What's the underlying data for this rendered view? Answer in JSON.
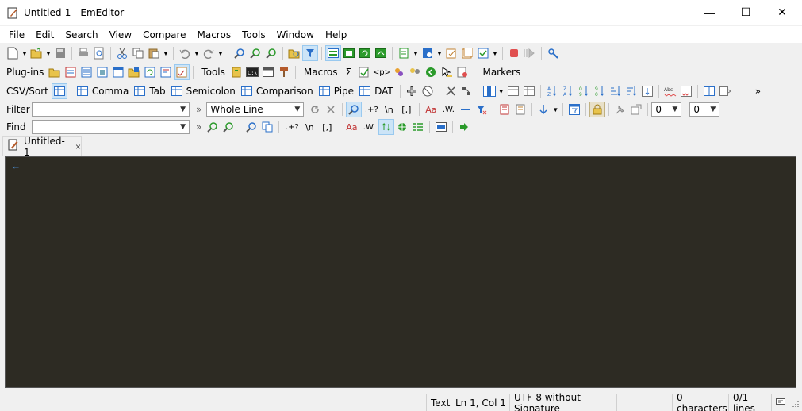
{
  "window": {
    "title": "Untitled-1 - EmEditor",
    "controls": {
      "minimize": "—",
      "maximize": "☐",
      "close": "✕"
    }
  },
  "menubar": [
    "File",
    "Edit",
    "Search",
    "View",
    "Compare",
    "Macros",
    "Tools",
    "Window",
    "Help"
  ],
  "pluginbar": {
    "plugins_label": "Plug-ins",
    "tools_label": "Tools",
    "macros_label": "Macros",
    "sigma": "Σ",
    "p_tag": "<p>",
    "markers_label": "Markers"
  },
  "csvbar": {
    "label": "CSV/Sort",
    "modes": [
      "Comma",
      "Tab",
      "Semicolon",
      "Comparison",
      "Pipe",
      "DAT"
    ],
    "overflow": "»"
  },
  "filterbar": {
    "label": "Filter",
    "value": "",
    "overflow": "»",
    "scope": "Whole Line",
    "regex_btn": ".+?",
    "newline_btn": "\\n",
    "bracket_btn": "[,]",
    "case_btn": "Aa",
    "word_btn": ".W.",
    "num1": "0",
    "num2": "0"
  },
  "findbar": {
    "label": "Find",
    "value": "",
    "overflow": "»",
    "regex_btn": ".+?",
    "newline_btn": "\\n",
    "bracket_btn": "[,]",
    "case_btn": "Aa",
    "word_btn": ".W."
  },
  "tabs": [
    {
      "label": "Untitled-1",
      "close": "×"
    }
  ],
  "editor": {
    "eol_marker": "←"
  },
  "statusbar": {
    "mode": "Text",
    "position": "Ln 1, Col 1",
    "encoding": "UTF-8 without Signature",
    "chars": "0 characters",
    "lines": "0/1 lines"
  },
  "colors": {
    "editor_bg": "#2d2b23",
    "eol_marker": "#4a8ccf",
    "accent_blue": "#2a6fc9",
    "record_red": "#e05050"
  }
}
